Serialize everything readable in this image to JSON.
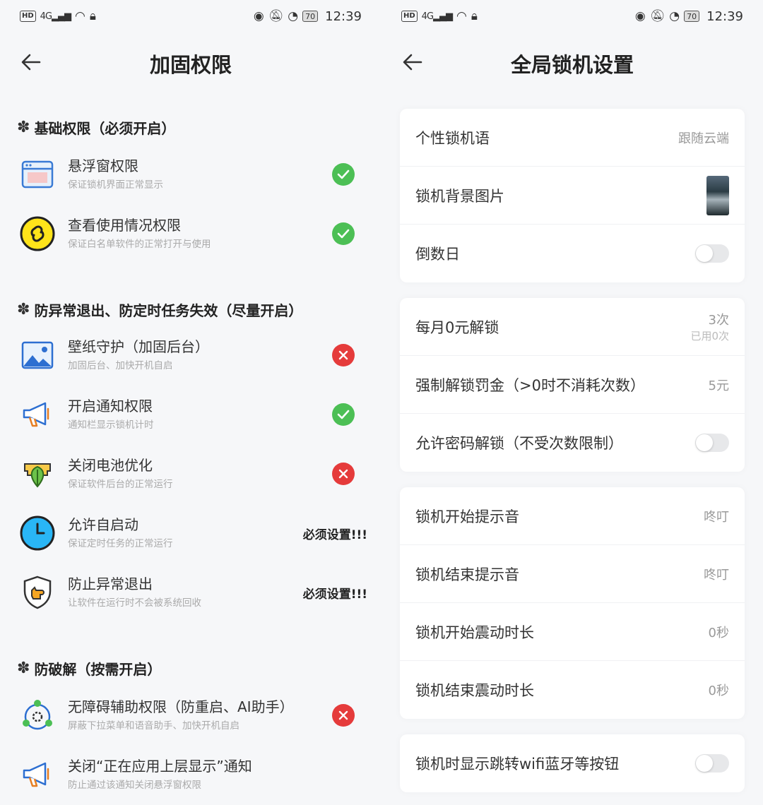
{
  "status_bar": {
    "hd": "HD",
    "signal": "4G",
    "battery": "70",
    "time": "12:39"
  },
  "left": {
    "title": "加固权限",
    "sections": [
      {
        "title": "基础权限（必须开启）",
        "items": [
          {
            "icon": "window-icon",
            "name": "悬浮窗权限",
            "desc": "保证锁机界面正常显示",
            "state": "ok"
          },
          {
            "icon": "link-icon",
            "name": "查看使用情况权限",
            "desc": "保证白名单软件的正常打开与使用",
            "state": "ok"
          }
        ]
      },
      {
        "title": "防异常退出、防定时任务失效（尽量开启）",
        "items": [
          {
            "icon": "image-icon",
            "name": "壁纸守护（加固后台）",
            "desc": "加固后台、加快开机自启",
            "state": "bad"
          },
          {
            "icon": "megaphone-icon",
            "name": "开启通知权限",
            "desc": "通知栏显示锁机计时",
            "state": "ok"
          },
          {
            "icon": "leaf-battery-icon",
            "name": "关闭电池优化",
            "desc": "保证软件后台的正常运行",
            "state": "bad"
          },
          {
            "icon": "clock-icon",
            "name": "允许自启动",
            "desc": "保证定时任务的正常运行",
            "state": "must",
            "must_label": "必须设置!!!"
          },
          {
            "icon": "shield-hand-icon",
            "name": "防止异常退出",
            "desc": "让软件在运行时不会被系统回收",
            "state": "must",
            "must_label": "必须设置!!!"
          }
        ]
      },
      {
        "title": "防破解（按需开启）",
        "items": [
          {
            "icon": "accessibility-gear-icon",
            "name": "无障碍辅助权限（防重启、AI助手）",
            "desc": "屏蔽下拉菜单和语音助手、加快开机自启",
            "state": "bad"
          },
          {
            "icon": "megaphone-icon",
            "name": "关闭“正在应用上层显示”通知",
            "desc": "防止通过该通知关闭悬浮窗权限",
            "state": "none"
          }
        ]
      }
    ]
  },
  "right": {
    "title": "全局锁机设置",
    "cards": [
      {
        "rows": [
          {
            "label": "个性锁机语",
            "value": "跟随云端"
          },
          {
            "label": "锁机背景图片",
            "type": "thumb"
          },
          {
            "label": "倒数日",
            "type": "toggle",
            "on": false
          }
        ]
      },
      {
        "rows": [
          {
            "label": "每月0元解锁",
            "value": "3次",
            "sub": "已用0次"
          },
          {
            "label": "强制解锁罚金（>0时不消耗次数）",
            "value": "5元"
          },
          {
            "label": "允许密码解锁（不受次数限制）",
            "type": "toggle",
            "on": false
          }
        ]
      },
      {
        "rows": [
          {
            "label": "锁机开始提示音",
            "value": "咚叮"
          },
          {
            "label": "锁机结束提示音",
            "value": "咚叮"
          },
          {
            "label": "锁机开始震动时长",
            "value": "0秒"
          },
          {
            "label": "锁机结束震动时长",
            "value": "0秒"
          }
        ]
      },
      {
        "rows": [
          {
            "label": "锁机时显示跳转wifi蓝牙等按钮",
            "type": "toggle",
            "on": false
          }
        ]
      }
    ]
  }
}
